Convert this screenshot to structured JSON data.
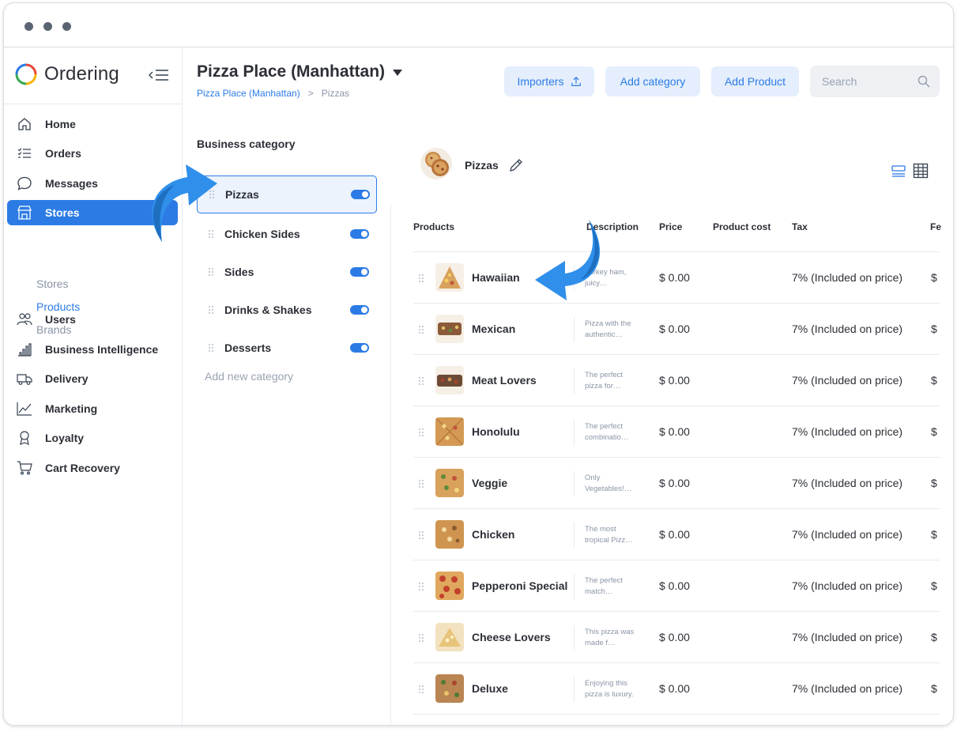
{
  "sidebar": {
    "brand": "Ordering",
    "nav": [
      {
        "label": "Home",
        "icon": "home-icon"
      },
      {
        "label": "Orders",
        "icon": "list-icon"
      },
      {
        "label": "Messages",
        "icon": "chat-icon"
      },
      {
        "label": "Stores",
        "icon": "store-icon",
        "active": true
      },
      {
        "label": "Users",
        "icon": "users-icon"
      },
      {
        "label": "Business Intelligence",
        "icon": "bar-chart-icon"
      },
      {
        "label": "Delivery",
        "icon": "truck-icon"
      },
      {
        "label": "Marketing",
        "icon": "line-chart-icon"
      },
      {
        "label": "Loyalty",
        "icon": "award-icon"
      },
      {
        "label": "Cart Recovery",
        "icon": "cart-icon"
      }
    ],
    "stores_submenu": [
      {
        "label": "Stores"
      },
      {
        "label": "Products",
        "active": true
      },
      {
        "label": "Brands"
      }
    ]
  },
  "header": {
    "title": "Pizza Place (Manhattan)",
    "breadcrumb": {
      "store": "Pizza Place (Manhattan)",
      "separator": ">",
      "current": "Pizzas"
    },
    "importers_label": "Importers",
    "add_category_label": "Add category",
    "add_product_label": "Add Product",
    "search_placeholder": "Search"
  },
  "categories": {
    "label": "Business category",
    "items": [
      {
        "name": "Pizzas",
        "enabled": true,
        "selected": true
      },
      {
        "name": "Chicken Sides",
        "enabled": true
      },
      {
        "name": "Sides",
        "enabled": true
      },
      {
        "name": "Drinks & Shakes",
        "enabled": true
      },
      {
        "name": "Desserts",
        "enabled": true
      }
    ],
    "add_new": "Add new category"
  },
  "products": {
    "category_name": "Pizzas",
    "columns": {
      "products": "Products",
      "description": "Description",
      "price": "Price",
      "cost": "Product cost",
      "tax": "Tax",
      "fee": "Fe"
    },
    "rows": [
      {
        "name": "Hawaiian",
        "desc": "Turkey ham, juicy…",
        "price": "$ 0.00",
        "tax": "7% (Included on price)",
        "fee": "$"
      },
      {
        "name": "Mexican",
        "desc": "Pizza with the authentic…",
        "price": "$ 0.00",
        "tax": "7% (Included on price)",
        "fee": "$"
      },
      {
        "name": "Meat Lovers",
        "desc": "The perfect pizza for…",
        "price": "$ 0.00",
        "tax": "7% (Included on price)",
        "fee": "$"
      },
      {
        "name": "Honolulu",
        "desc": "The perfect combinatio…",
        "price": "$ 0.00",
        "tax": "7% (Included on price)",
        "fee": "$"
      },
      {
        "name": "Veggie",
        "desc": "Only Vegetables!…",
        "price": "$ 0.00",
        "tax": "7% (Included on price)",
        "fee": "$"
      },
      {
        "name": "Chicken",
        "desc": "The most tropical Pizz…",
        "price": "$ 0.00",
        "tax": "7% (Included on price)",
        "fee": "$"
      },
      {
        "name": "Pepperoni Special",
        "desc": "The perfect match…",
        "price": "$ 0.00",
        "tax": "7% (Included on price)",
        "fee": "$"
      },
      {
        "name": "Cheese Lovers",
        "desc": "This pizza was made f…",
        "price": "$ 0.00",
        "tax": "7% (Included on price)",
        "fee": "$"
      },
      {
        "name": "Deluxe",
        "desc": "Enjoying this pizza is luxury.",
        "price": "$ 0.00",
        "tax": "7% (Included on price)",
        "fee": "$"
      }
    ]
  },
  "colors": {
    "accent": "#2c7be5",
    "button_bg": "#e4eefc",
    "arrow": "#2f8fea"
  }
}
